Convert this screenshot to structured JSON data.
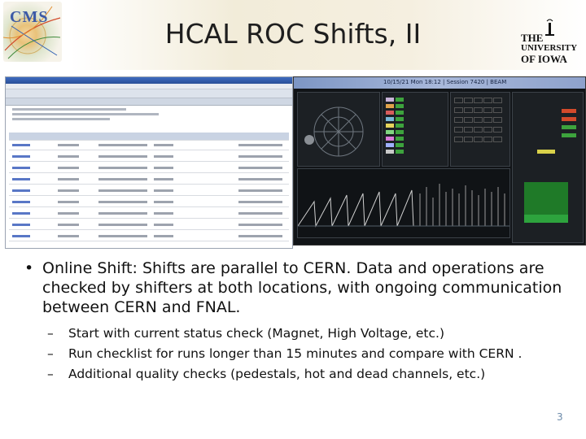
{
  "slide": {
    "title": "HCAL ROC Shifts, II",
    "page_number": "3"
  },
  "logos": {
    "cms": "CMS",
    "iowa_the": "THE",
    "iowa_university": "UNIVERSITY",
    "iowa_of": "OF IOWA"
  },
  "screenshots": {
    "right_title": "10/15/21 Mon 18:12 | Session 7420 | BEAM"
  },
  "bullets": {
    "main": "Online Shift: Shifts are parallel to CERN. Data and operations are checked by shifters at both locations, with ongoing communication between CERN and FNAL.",
    "main_marker": "•",
    "sub_marker": "–",
    "sub": [
      " Start with current status check (Magnet, High Voltage, etc.)",
      "Run checklist for runs longer than 15 minutes and compare with CERN .",
      "Additional quality checks (pedestals, hot and dead channels, etc.)"
    ]
  },
  "colors": {
    "title_text": "#1e1e1e",
    "page_number": "#6b8aa9",
    "status_green": "#3da33d"
  }
}
